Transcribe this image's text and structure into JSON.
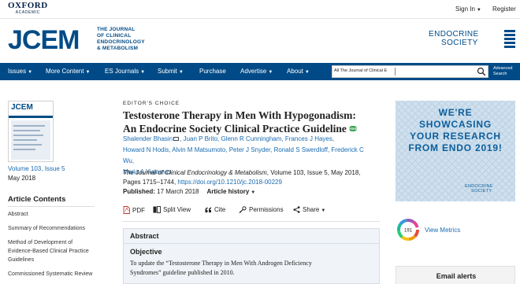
{
  "topbar": {
    "publisher_name": "OXFORD",
    "publisher_sub": "ACADEMIC",
    "sign_in": "Sign In",
    "register": "Register"
  },
  "masthead": {
    "journal_abbr": "JCEM",
    "journal_full_line1": "THE JOURNAL",
    "journal_full_line2": "OF CLINICAL",
    "journal_full_line3": "ENDOCRINOLOGY",
    "journal_full_line4": "& METABOLISM",
    "society_line1": "ENDOCRINE",
    "society_line2": "SOCIETY"
  },
  "nav": {
    "items": [
      {
        "label": "Issues"
      },
      {
        "label": "More Content"
      },
      {
        "label": "ES Journals"
      },
      {
        "label": "Submit"
      },
      {
        "label": "Purchase"
      },
      {
        "label": "Advertise"
      },
      {
        "label": "About"
      }
    ],
    "search_scope": "All The Journal of Clinical E",
    "advanced_search_line1": "Advanced",
    "advanced_search_line2": "Search"
  },
  "sidebar": {
    "cover_title": "JCEM",
    "volume_issue": "Volume 103, Issue 5",
    "issue_date": "May 2018",
    "contents_title": "Article Contents",
    "contents": [
      "Abstract",
      "Summary of Recommendations",
      "Method of Development of Evidence-Based Clinical Practice Guidelines",
      "Commissioned Systematic Review"
    ]
  },
  "article": {
    "label": "EDITOR'S CHOICE",
    "title": "Testosterone Therapy in Men With Hypogonadism: An Endocrine Society Clinical Practice Guideline",
    "free_badge": "FREE",
    "authors_line1_a": "Shalender Bhasin",
    "authors_line1_b": ", Juan P Brito, Glenn R Cunningham, Frances J Hayes,",
    "authors_line2": "Howard N Hodis, Alvin M Matsumoto, Peter J Snyder, Ronald S Swerdloff, Frederick C Wu,",
    "authors_line3": "Maria A Yialamas",
    "journal_name": "The Journal of Clinical Endocrinology & Metabolism",
    "citation_rest": ", Volume 103, Issue 5, May 2018, Pages 1715–1744,",
    "doi": "https://doi.org/10.1210/jc.2018-00229",
    "published_label": "Published:",
    "published_date": "17 March 2018",
    "history_label": "Article history"
  },
  "toolbar": {
    "pdf": "PDF",
    "split_view": "Split View",
    "cite": "Cite",
    "permissions": "Permissions",
    "share": "Share"
  },
  "abstract": {
    "heading": "Abstract",
    "subheading": "Objective",
    "text_line1": "To update the “Testosterone Therapy in Men With Androgen Deficiency",
    "text_line2": "Syndromes” guideline published in 2010."
  },
  "right": {
    "ad_line1": "WE'RE",
    "ad_line2": "SHOWCASING",
    "ad_line3": "YOUR RESEARCH",
    "ad_line4": "FROM ENDO 2019!",
    "ad_sponsor_line1": "ENDOCRINE",
    "ad_sponsor_line2": "SOCIETY",
    "altmetric_score": "191",
    "view_metrics": "View Metrics",
    "email_alerts": "Email alerts"
  },
  "colors": {
    "brand_blue": "#004b87",
    "link_blue": "#1a6bb0",
    "free_green": "#3aa655"
  }
}
